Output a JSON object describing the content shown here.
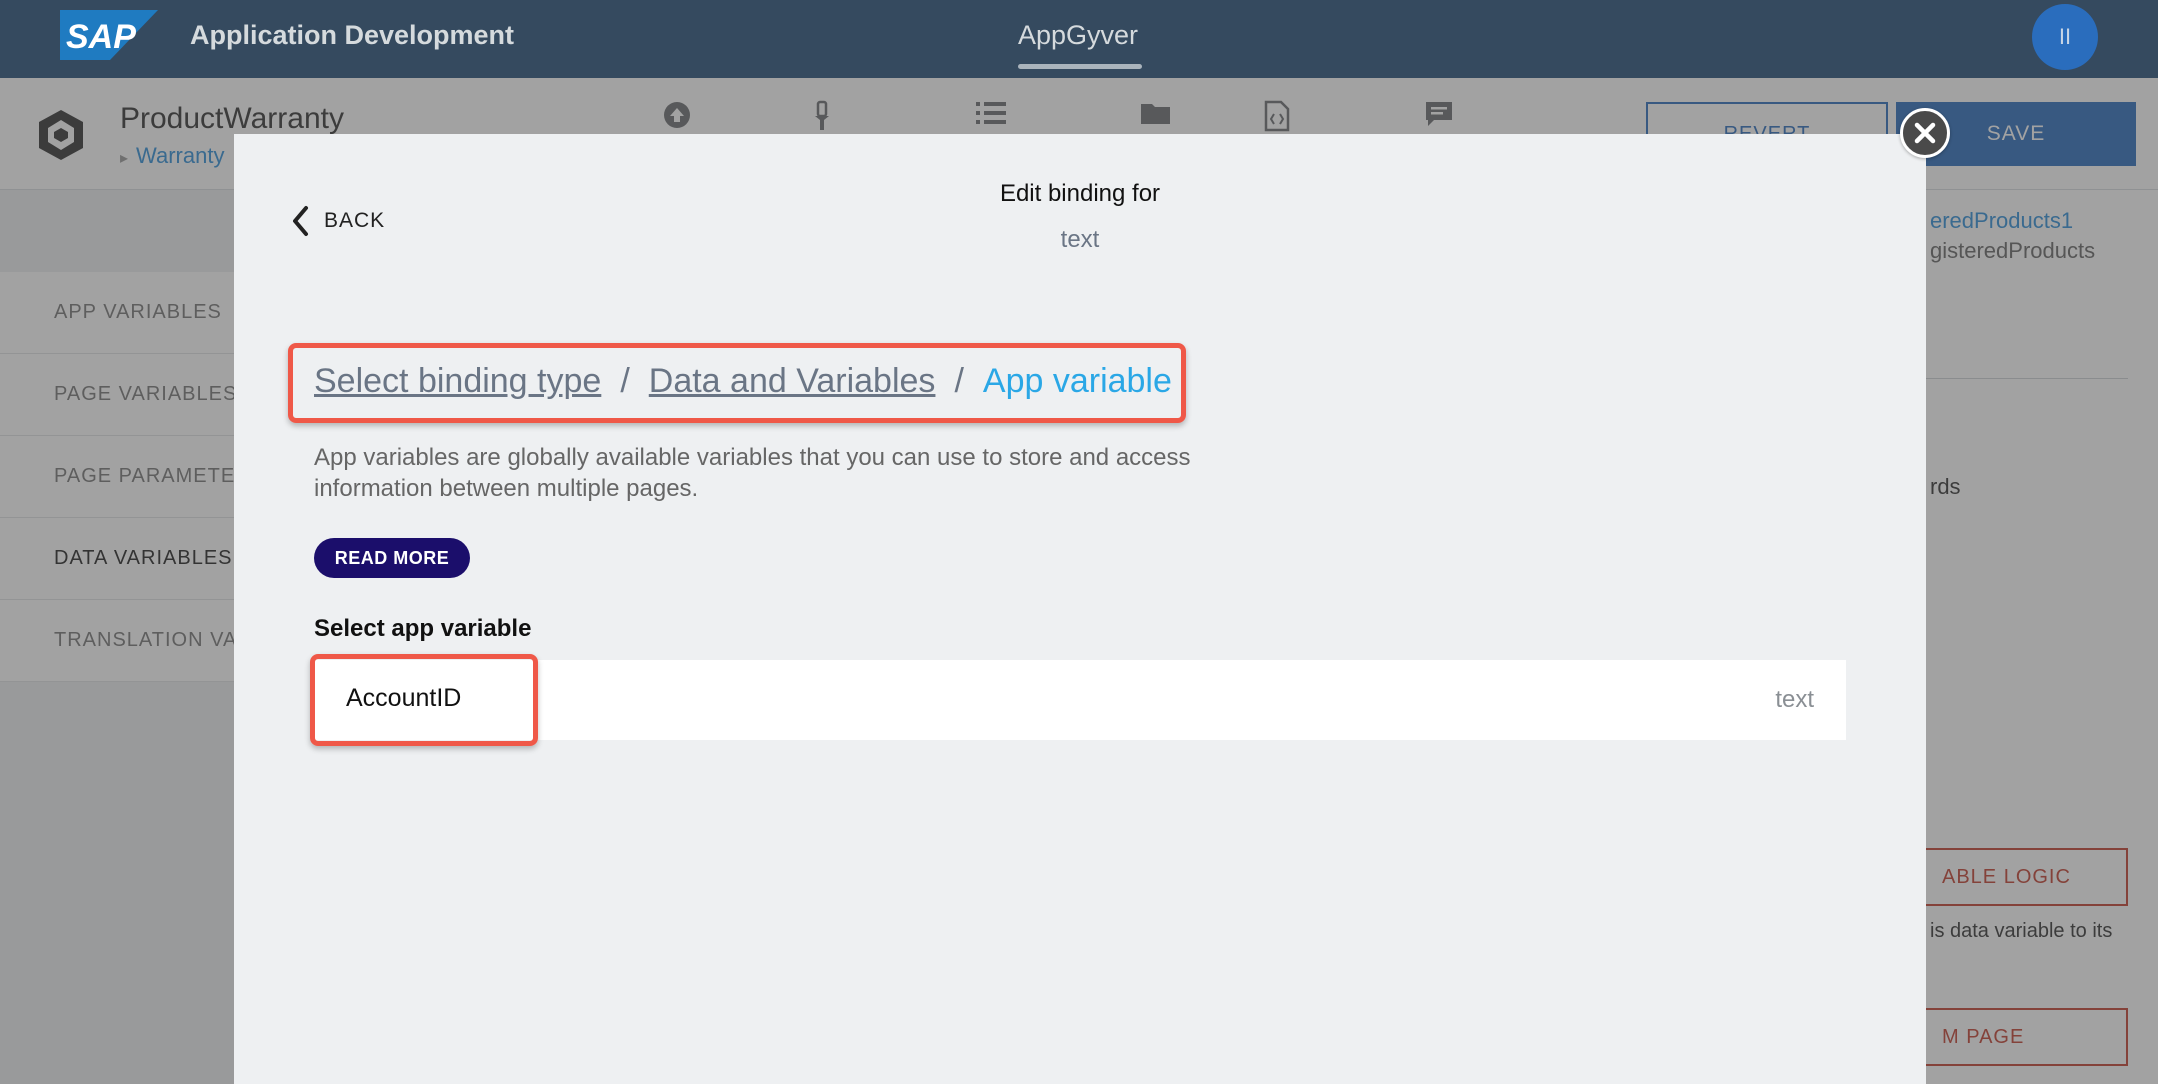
{
  "shell": {
    "brand": "SAP",
    "title": "Application Development",
    "center_tab": "AppGyver",
    "avatar_initials": "II"
  },
  "app": {
    "project_name": "ProductWarranty",
    "page_name": "Warranty",
    "toolbar_icons": [
      "upload-icon",
      "pin-icon",
      "list-icon",
      "folder-icon",
      "code-file-icon",
      "chat-icon"
    ],
    "revert_label": "REVERT",
    "save_label": "SAVE"
  },
  "left_panel": {
    "items": [
      {
        "label": "APP VARIABLES"
      },
      {
        "label": "PAGE VARIABLES"
      },
      {
        "label": "PAGE PARAMETERS"
      },
      {
        "label": "DATA VARIABLES"
      },
      {
        "label": "TRANSLATION VA"
      }
    ]
  },
  "right_panel": {
    "line1": "eredProducts1",
    "line2": "gisteredProducts",
    "line3": "rds",
    "button1": "ABLE LOGIC",
    "line4": "is data variable to its",
    "button2": "M PAGE"
  },
  "modal": {
    "back_label": "BACK",
    "title": "Edit binding for",
    "subtitle": "text",
    "breadcrumb": {
      "step1": "Select binding type",
      "separator": "/",
      "step2": "Data and Variables",
      "current": "App variable"
    },
    "description": "App variables are globally available variables that you can use to store and access information between multiple pages.",
    "read_more_label": "READ MORE",
    "select_label": "Select app variable",
    "variables": [
      {
        "name": "AccountID",
        "type": "text"
      }
    ]
  },
  "colors": {
    "shellbar": "#354a5f",
    "accent_blue": "#2a6dbd",
    "highlight_red": "#ef5848",
    "crumb_current": "#2aa7e6",
    "read_more_bg": "#1b0e6b"
  }
}
